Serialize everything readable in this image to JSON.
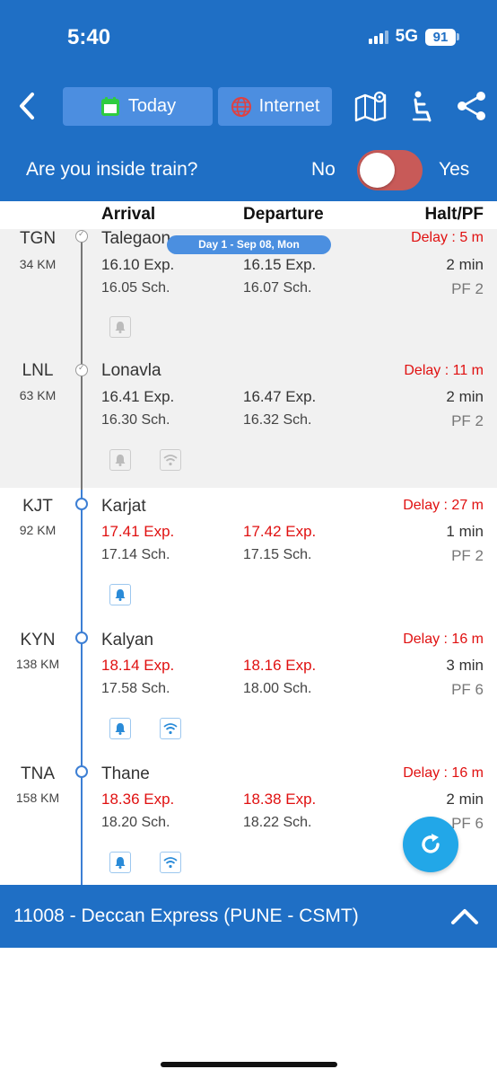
{
  "status_bar": {
    "time": "5:40",
    "network": "5G",
    "battery": "91"
  },
  "header": {
    "today_label": "Today",
    "internet_label": "Internet"
  },
  "inside_train": {
    "question": "Are you inside train?",
    "no_label": "No",
    "yes_label": "Yes",
    "enabled": false
  },
  "columns": {
    "arrival": "Arrival",
    "departure": "Departure",
    "halt_pf": "Halt/PF"
  },
  "day_badge": "Day 1 - Sep 08, Mon",
  "stations": [
    {
      "code": "TGN",
      "km": "34 KM",
      "name": "Talegaon",
      "delay": "Delay : 5 m",
      "arr_exp": "16.10 Exp.",
      "arr_sch": "16.05 Sch.",
      "dep_exp": "16.15 Exp.",
      "dep_sch": "16.07 Sch.",
      "halt": "2 min",
      "pf": "PF 2"
    },
    {
      "code": "LNL",
      "km": "63 KM",
      "name": "Lonavla",
      "delay": "Delay : 11 m",
      "arr_exp": "16.41 Exp.",
      "arr_sch": "16.30 Sch.",
      "dep_exp": "16.47 Exp.",
      "dep_sch": "16.32 Sch.",
      "halt": "2 min",
      "pf": "PF 2"
    },
    {
      "code": "KJT",
      "km": "92 KM",
      "name": "Karjat",
      "delay": "Delay : 27 m",
      "arr_exp": "17.41 Exp.",
      "arr_sch": "17.14 Sch.",
      "dep_exp": "17.42 Exp.",
      "dep_sch": "17.15 Sch.",
      "halt": "1 min",
      "pf": "PF 2"
    },
    {
      "code": "KYN",
      "km": "138 KM",
      "name": "Kalyan",
      "delay": "Delay : 16 m",
      "arr_exp": "18.14 Exp.",
      "arr_sch": "17.58 Sch.",
      "dep_exp": "18.16 Exp.",
      "dep_sch": "18.00 Sch.",
      "halt": "3 min",
      "pf": "PF 6"
    },
    {
      "code": "TNA",
      "km": "158 KM",
      "name": "Thane",
      "delay": "Delay : 16 m",
      "arr_exp": "18.36 Exp.",
      "arr_sch": "18.20 Sch.",
      "dep_exp": "18.38 Exp.",
      "dep_sch": "18.22 Sch.",
      "halt": "2 min",
      "pf": "PF 6"
    }
  ],
  "train_title": "11008 - Deccan Express (PUNE - CSMT)",
  "colors": {
    "primary": "#1f6fc5",
    "delay_red": "#e01010",
    "toggle_off": "#c85a58",
    "refresh": "#22a7e8"
  }
}
